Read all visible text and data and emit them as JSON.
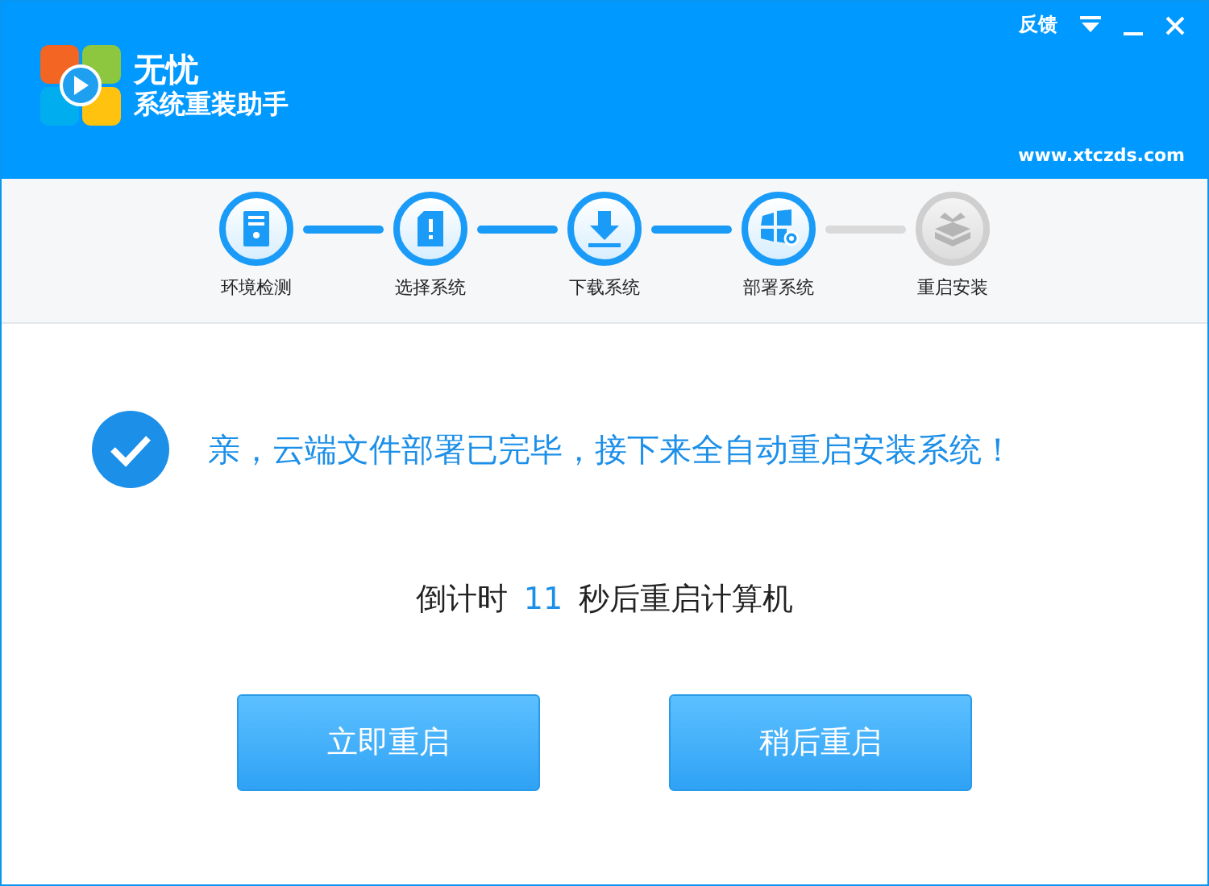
{
  "window": {
    "feedback": "反馈",
    "website": "www.xtczds.com"
  },
  "app": {
    "name": "无忧",
    "subtitle": "系统重装助手"
  },
  "steps": [
    {
      "label": "环境检测",
      "kind": "computer",
      "done": true
    },
    {
      "label": "选择系统",
      "kind": "document",
      "done": true
    },
    {
      "label": "下载系统",
      "kind": "download",
      "done": true
    },
    {
      "label": "部署系统",
      "kind": "deploy",
      "done": true
    },
    {
      "label": "重启安装",
      "kind": "box",
      "done": false
    }
  ],
  "message": "亲，云端文件部署已完毕，接下来全自动重启安装系统！",
  "countdown": {
    "prefix": "倒计时",
    "seconds": "11",
    "suffix": "秒后重启计算机"
  },
  "buttons": [
    "立即重启",
    "稍后重启"
  ]
}
